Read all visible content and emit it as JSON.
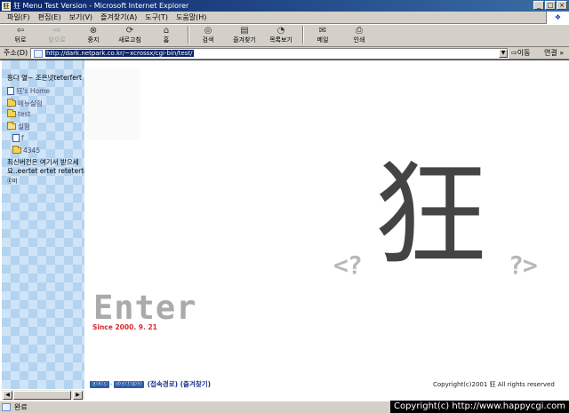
{
  "window": {
    "app_icon": "狂",
    "title": "狂 Menu Test Version - Microsoft Internet Explorer",
    "minimize": "_",
    "maximize": "□",
    "close": "×"
  },
  "menu": [
    "파일(F)",
    "편집(E)",
    "보기(V)",
    "즐겨찾기(A)",
    "도구(T)",
    "도움말(H)"
  ],
  "toolbar": {
    "back": "뒤로",
    "forward": "앞으로",
    "stop": "중지",
    "refresh": "새로고침",
    "home": "홈",
    "search": "검색",
    "favorites": "즐겨찾기",
    "history": "목록보기",
    "mail": "메일",
    "print": "인쇄"
  },
  "address": {
    "label": "주소(D)",
    "url": "http://dark.netpark.co.kr/~xcrossx/cgi-bin/test/",
    "go": "이동",
    "links": "연결 »"
  },
  "sidebar": {
    "header": "흥다 열~ 조은넷teterfert",
    "items": [
      {
        "label": "狂's Home",
        "icon": "page-icon"
      },
      {
        "label": "메뉴실험",
        "icon": "folder-icon"
      },
      {
        "label": "test",
        "icon": "folder-icon"
      },
      {
        "label": "실험",
        "icon": "folder-open-icon"
      },
      {
        "label": "f",
        "icon": "page-icon"
      },
      {
        "label": "4345",
        "icon": "folder-icon"
      }
    ],
    "latest_line1": "최신버전은 여기서 받으세",
    "latest_line2": "요..eertet ertet reteterterte",
    "mini": "Ⓔ미"
  },
  "main": {
    "kanji": "狂",
    "bracket_left": "<?",
    "bracket_right": "?>",
    "enter": "Enter",
    "since": "Since 2000. 9. 21",
    "badge1": "ⓐⓑⓒ",
    "badge_sep": "-",
    "badge2": "ⓓⓔⓕⓖⓗ",
    "link_label": "(접속경로) (즐겨찾기)",
    "copyright": "Copyright(c)2001 狂 All rights reserved"
  },
  "status": {
    "text": "완료"
  },
  "watermark": "Copyright(c) http://www.happycgi.com",
  "colors": {
    "title_bar": "#0a246a",
    "sidebar_check_light": "#cfe4f7",
    "sidebar_check_dark": "#b3d3ef",
    "since_text": "#d8282c",
    "kanji": "#444444",
    "enter_text": "#aaaaaa"
  }
}
